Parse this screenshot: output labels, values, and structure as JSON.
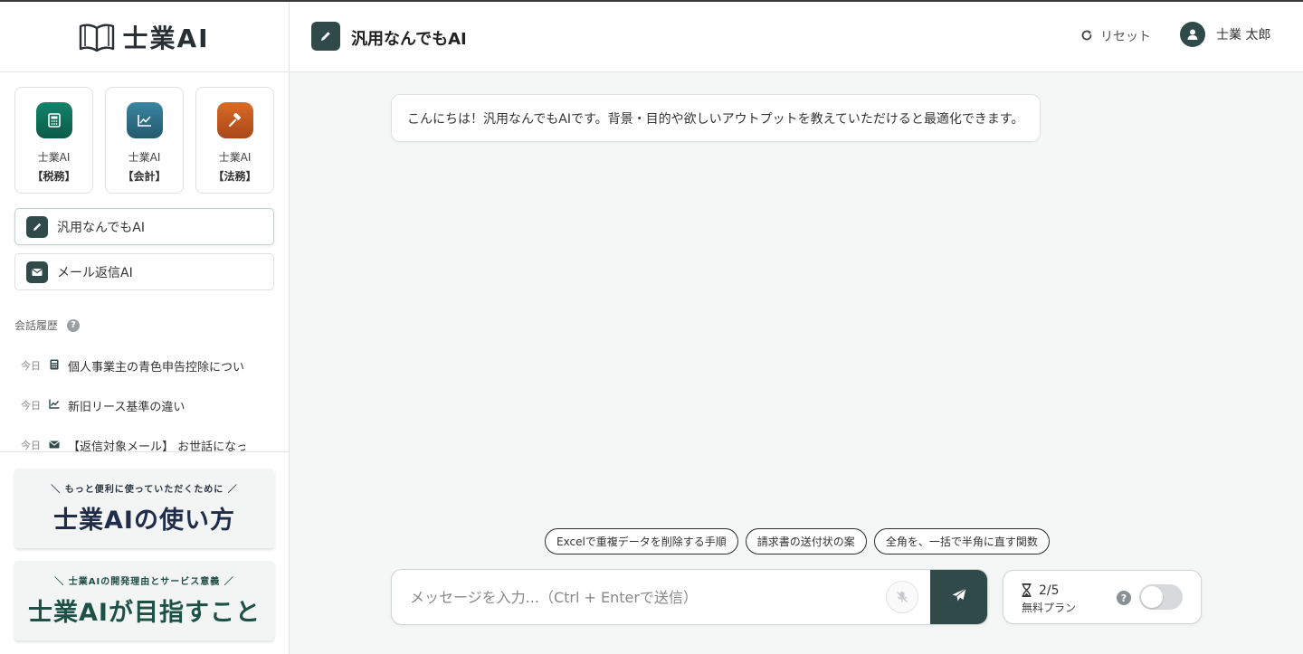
{
  "app": {
    "logo_text": "士業AI",
    "logo_icon": "book-icon"
  },
  "specialist_cards": [
    {
      "line1": "士業AI",
      "line2": "【税務】",
      "icon": "calculator-icon",
      "color": "#11705a"
    },
    {
      "line1": "士業AI",
      "line2": "【会計】",
      "icon": "chart-line-icon",
      "color": "#2a6e84"
    },
    {
      "line1": "士業AI",
      "line2": "【法務】",
      "icon": "gavel-icon",
      "color": "#c2571d"
    }
  ],
  "nav": [
    {
      "label": "汎用なんでもAI",
      "icon": "pencil-icon",
      "active": true
    },
    {
      "label": "メール返信AI",
      "icon": "envelope-icon",
      "active": false
    }
  ],
  "history": {
    "title": "会話履歴",
    "help": "?",
    "items": [
      {
        "day": "今日",
        "icon": "calculator-icon",
        "text": "個人事業主の青色申告控除について教"
      },
      {
        "day": "今日",
        "icon": "chart-line-icon",
        "text": "新旧リース基準の違い"
      },
      {
        "day": "今日",
        "icon": "envelope-icon",
        "text": "【返信対象メール】 お世話になって"
      }
    ]
  },
  "banners": [
    {
      "sub": "＼ もっと便利に使っていただくために ／",
      "main": "士業AIの使い方"
    },
    {
      "sub": "＼ 士業AIの開発理由とサービス意義 ／",
      "main": "士業AIが目指すこと"
    }
  ],
  "header": {
    "title": "汎用なんでもAI",
    "icon": "pencil-icon",
    "reset_label": "リセット",
    "reset_icon": "refresh-icon",
    "user_name": "士業 太郎"
  },
  "chat": {
    "messages": [
      {
        "role": "assistant",
        "text": "こんにちは！汎用なんでもAIです。背景・目的や欲しいアウトプットを教えていただけると最適化できます。"
      }
    ],
    "suggestions": [
      "Excelで重複データを削除する手順",
      "請求書の送付状の案",
      "全角を、一括で半角に直す関数"
    ],
    "input_placeholder": "メッセージを入力...（Ctrl + Enterで送信）",
    "input_value": ""
  },
  "quota": {
    "count": "2/5",
    "plan": "無料プラン",
    "help": "?",
    "toggle_on": false
  },
  "colors": {
    "primary": "#2f4a48",
    "background": "#f5f6f6"
  }
}
